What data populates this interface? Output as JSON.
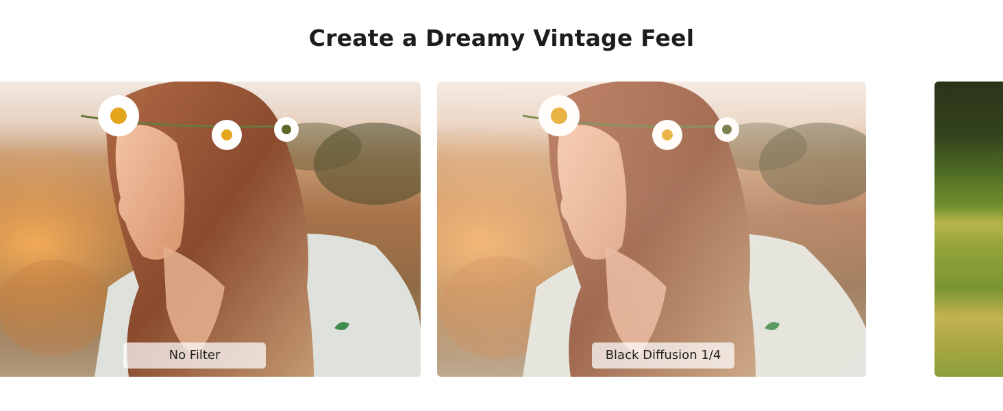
{
  "header": {
    "title": "Create a Dreamy Vintage Feel"
  },
  "comparison": {
    "slides": [
      {
        "label": "No Filter"
      },
      {
        "label": "Black Diffusion 1/4"
      },
      {
        "label": ""
      }
    ]
  }
}
